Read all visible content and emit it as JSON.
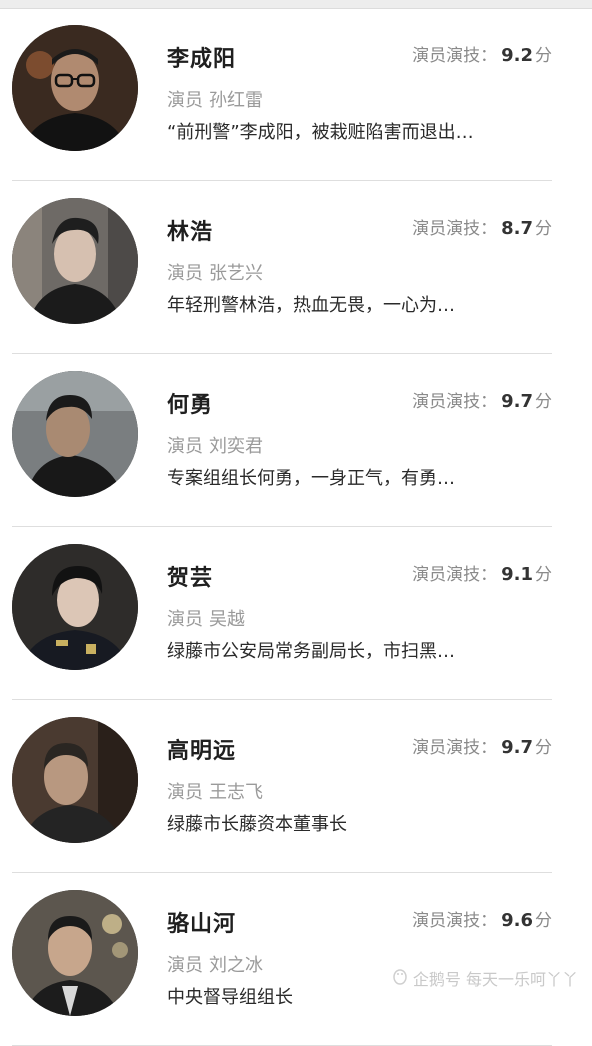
{
  "characters": [
    {
      "name": "李成阳",
      "rating_label": "演员演技：",
      "score": "9.2",
      "score_unit": "分",
      "actor_label": "演员",
      "actor": "孙红雷",
      "description": "“前刑警”李成阳，被栽赃陷害而退出…"
    },
    {
      "name": "林浩",
      "rating_label": "演员演技：",
      "score": "8.7",
      "score_unit": "分",
      "actor_label": "演员",
      "actor": "张艺兴",
      "description": "年轻刑警林浩，热血无畏，一心为…"
    },
    {
      "name": "何勇",
      "rating_label": "演员演技：",
      "score": "9.7",
      "score_unit": "分",
      "actor_label": "演员",
      "actor": "刘奕君",
      "description": "专案组组长何勇，一身正气，有勇…"
    },
    {
      "name": "贺芸",
      "rating_label": "演员演技：",
      "score": "9.1",
      "score_unit": "分",
      "actor_label": "演员",
      "actor": "吴越",
      "description": "绿藤市公安局常务副局长，市扫黑…"
    },
    {
      "name": "高明远",
      "rating_label": "演员演技：",
      "score": "9.7",
      "score_unit": "分",
      "actor_label": "演员",
      "actor": "王志飞",
      "description": "绿藤市长藤资本董事长"
    },
    {
      "name": "骆山河",
      "rating_label": "演员演技：",
      "score": "9.6",
      "score_unit": "分",
      "actor_label": "演员",
      "actor": "刘之冰",
      "description": "中央督导组组长"
    }
  ],
  "watermark": {
    "text": "企鹅号 每天一乐呵丫丫",
    "icon": "penguin-icon"
  },
  "colors": {
    "name": "#1f1f1f",
    "meta": "#9a9a9a",
    "score": "#333333",
    "divider": "#dedede"
  }
}
